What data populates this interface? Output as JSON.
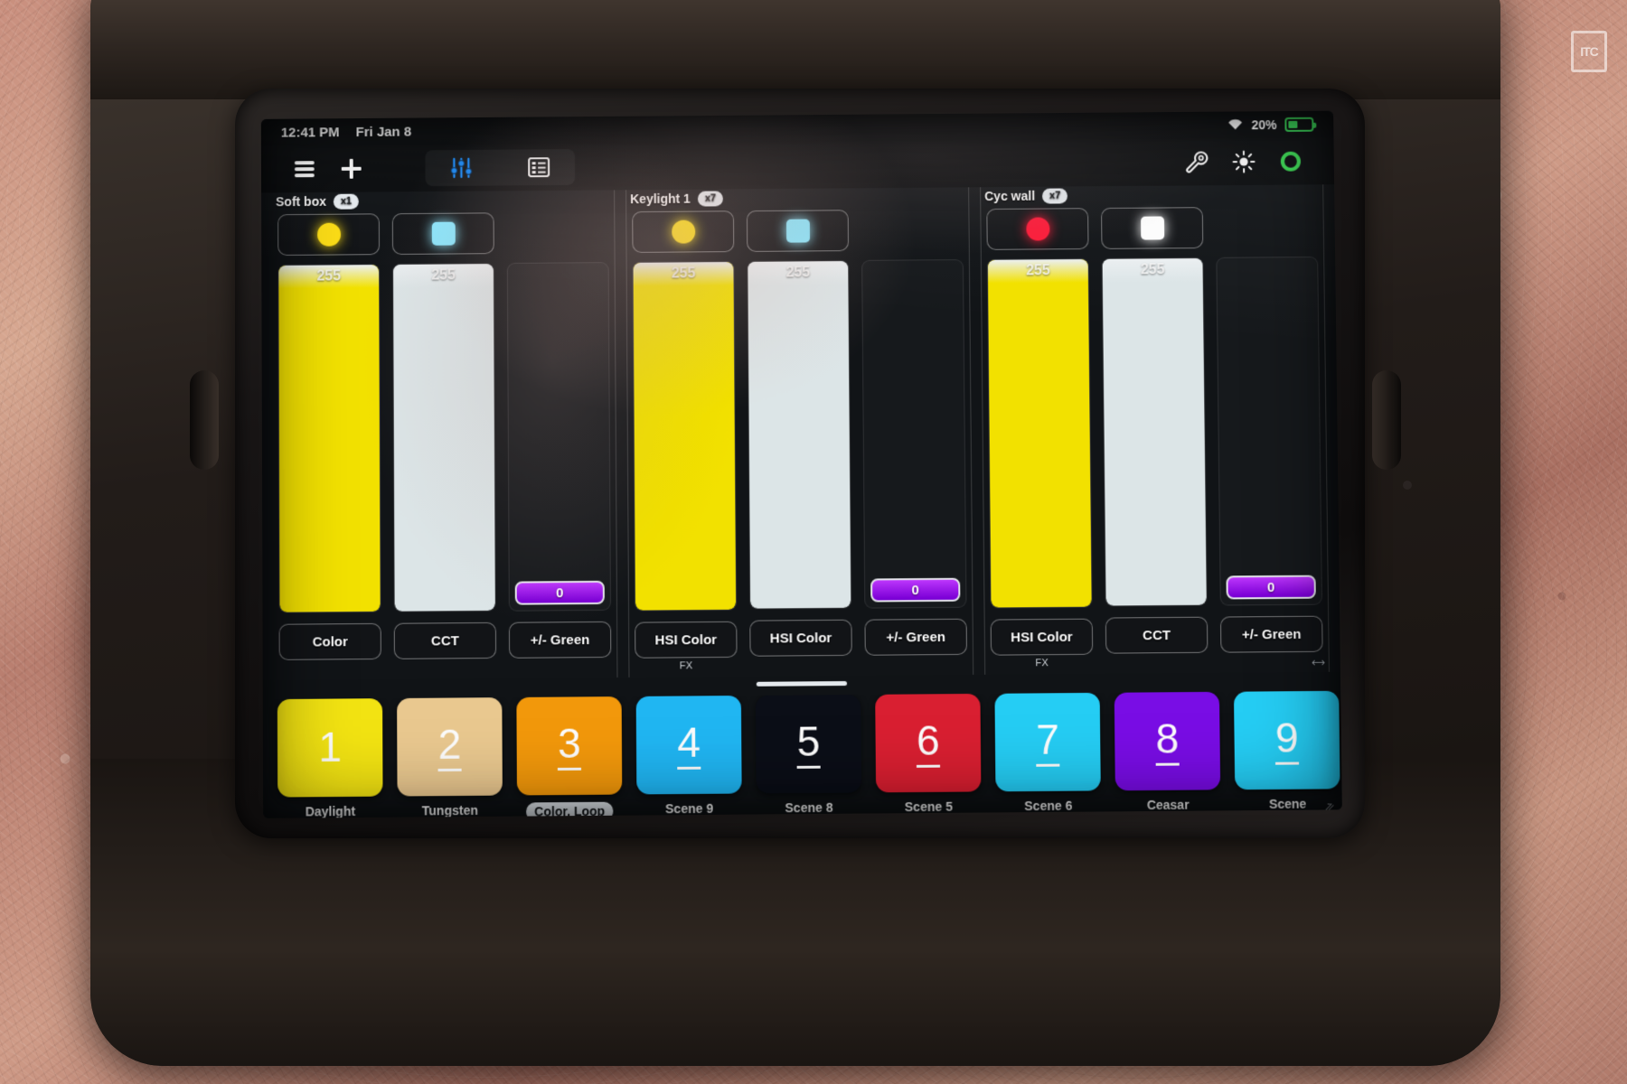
{
  "watermark": {
    "text": "ITC"
  },
  "status_bar": {
    "time": "12:41 PM",
    "date": "Fri Jan 8",
    "wifi_icon": "wifi-icon",
    "battery_percent": "20%",
    "battery_icon": "battery-charging-icon"
  },
  "toolbar": {
    "menu_icon": "hamburger-menu-icon",
    "add_icon": "plus-icon",
    "faders_icon": "faders-icon",
    "list_icon": "list-icon",
    "wrench_icon": "wrench-icon",
    "brightness_icon": "brightness-icon",
    "power_icon": "power-ring-icon",
    "accent_color": "#1e90ff",
    "power_color": "#3ddc55"
  },
  "groups": [
    {
      "name": "Soft box",
      "badge": "x1",
      "fx_label": "",
      "channels": [
        {
          "swatch_type": "dot",
          "swatch_color": "#ffe01a",
          "fader_value": "255",
          "fader_percent": 100,
          "fader_color": "#f5e400",
          "mode_label": "Color"
        },
        {
          "swatch_type": "square",
          "swatch_color": "#8fe9ff",
          "fader_value": "255",
          "fader_percent": 100,
          "fader_color": "#dfe8ea",
          "mode_label": "CCT"
        },
        {
          "swatch_type": "none",
          "swatch_color": "",
          "fader_value": "0",
          "fader_percent": 0,
          "fader_color": "#9b19e8",
          "mode_label": "+/- Green",
          "slider_style": "horizontal"
        }
      ]
    },
    {
      "name": "Keylight 1",
      "badge": "x7",
      "fx_label": "FX",
      "channels": [
        {
          "swatch_type": "dot",
          "swatch_color": "#ffe01a",
          "fader_value": "255",
          "fader_percent": 100,
          "fader_color": "#f5e400",
          "mode_label": "HSI Color"
        },
        {
          "swatch_type": "square",
          "swatch_color": "#8fe9ff",
          "fader_value": "255",
          "fader_percent": 100,
          "fader_color": "#dfe8ea",
          "mode_label": "HSI Color"
        },
        {
          "swatch_type": "none",
          "swatch_color": "",
          "fader_value": "0",
          "fader_percent": 0,
          "fader_color": "#9b19e8",
          "mode_label": "+/- Green",
          "slider_style": "horizontal"
        }
      ]
    },
    {
      "name": "Cyc wall",
      "badge": "x7",
      "fx_label": "FX",
      "channels": [
        {
          "swatch_type": "dot",
          "swatch_color": "#ff1e3c",
          "fader_value": "255",
          "fader_percent": 100,
          "fader_color": "#f5e400",
          "mode_label": "HSI Color"
        },
        {
          "swatch_type": "square",
          "swatch_color": "#ffffff",
          "fader_value": "255",
          "fader_percent": 100,
          "fader_color": "#dfe8ea",
          "mode_label": "CCT"
        },
        {
          "swatch_type": "none",
          "swatch_color": "",
          "fader_value": "0",
          "fader_percent": 0,
          "fader_color": "#9b19e8",
          "mode_label": "+/- Green",
          "slider_style": "horizontal"
        }
      ]
    }
  ],
  "scenes": {
    "drag_handle": "drag-handle",
    "items": [
      {
        "number": "1",
        "name": "Daylight",
        "tile_color": "#f5e617",
        "number_color": "#ffffff",
        "underline": false,
        "selected": false
      },
      {
        "number": "2",
        "name": "Tungsten",
        "tile_color": "#eccb93",
        "number_color": "#ffffff",
        "underline": true,
        "selected": false
      },
      {
        "number": "3",
        "name": "Color. Loop",
        "tile_color": "#f59c10",
        "number_color": "#ffffff",
        "underline": true,
        "selected": true
      },
      {
        "number": "4",
        "name": "Scene 9",
        "tile_color": "#25b9f5",
        "number_color": "#ffffff",
        "underline": true,
        "selected": false
      },
      {
        "number": "5",
        "name": "Scene 8",
        "tile_color": "#10131c",
        "number_color": "#ffffff",
        "underline": true,
        "selected": false
      },
      {
        "number": "6",
        "name": "Scene 5",
        "tile_color": "#dc2436",
        "number_color": "#ffffff",
        "underline": true,
        "selected": false
      },
      {
        "number": "7",
        "name": "Scene 6",
        "tile_color": "#2ad0f7",
        "number_color": "#ffffff",
        "underline": true,
        "selected": false
      },
      {
        "number": "8",
        "name": "Ceasar",
        "tile_color": "#7d12e8",
        "number_color": "#ffffff",
        "underline": true,
        "selected": false
      },
      {
        "number": "9",
        "name": "Scene",
        "tile_color": "#2ad0f7",
        "number_color": "#ffffff",
        "underline": true,
        "selected": false
      }
    ]
  }
}
